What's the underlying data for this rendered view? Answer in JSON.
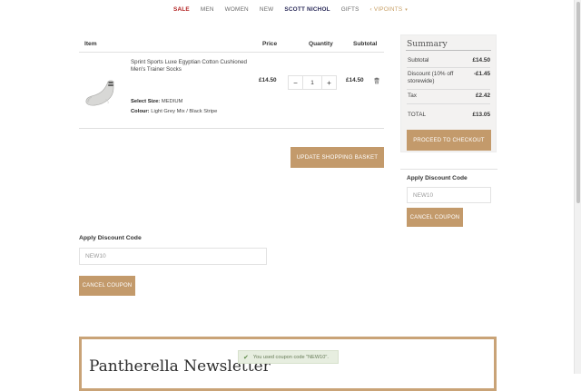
{
  "nav": {
    "items": [
      {
        "label": "SALE"
      },
      {
        "label": "MEN"
      },
      {
        "label": "WOMEN"
      },
      {
        "label": "NEW"
      },
      {
        "label": "SCOTT NICHOL"
      },
      {
        "label": "GIFTS"
      },
      {
        "label": "VIPOINTS"
      }
    ]
  },
  "cart": {
    "headers": {
      "item": "Item",
      "price": "Price",
      "quantity": "Quantity",
      "subtotal": "Subtotal"
    },
    "items": [
      {
        "name": "Sprint Sports Luxe Egyptian Cotton Cushioned Men's Trainer Socks",
        "size_label": "Select Size:",
        "size_value": "MEDIUM",
        "colour_label": "Colour:",
        "colour_value": "Light Grey Mix / Black Stripe",
        "price": "£14.50",
        "quantity": "1",
        "subtotal": "£14.50",
        "minus": "−",
        "plus": "+"
      }
    ],
    "update_button": "UPDATE SHOPPING BASKET"
  },
  "summary": {
    "title": "Summary",
    "rows": [
      {
        "label": "Subtotal",
        "value": "£14.50"
      },
      {
        "label": "Discount (10% off storewide)",
        "value": "-£1.45"
      },
      {
        "label": "Tax",
        "value": "£2.42"
      },
      {
        "label": "TOTAL",
        "value": "£13.05"
      }
    ],
    "checkout_button": "PROCEED TO CHECKOUT"
  },
  "side_discount": {
    "label": "Apply Discount Code",
    "value": "NEW10",
    "cancel_button": "CANCEL COUPON"
  },
  "main_discount": {
    "label": "Apply Discount Code",
    "value": "NEW10",
    "cancel_button": "CANCEL COUPON"
  },
  "newsletter": {
    "title": "Pantherella Newsletter"
  },
  "toast": {
    "message": "You used coupon code \"NEW10\"."
  },
  "colors": {
    "accent": "#c39a6b",
    "sale": "#b01e1e",
    "nav_bold": "#2b2b5a"
  }
}
